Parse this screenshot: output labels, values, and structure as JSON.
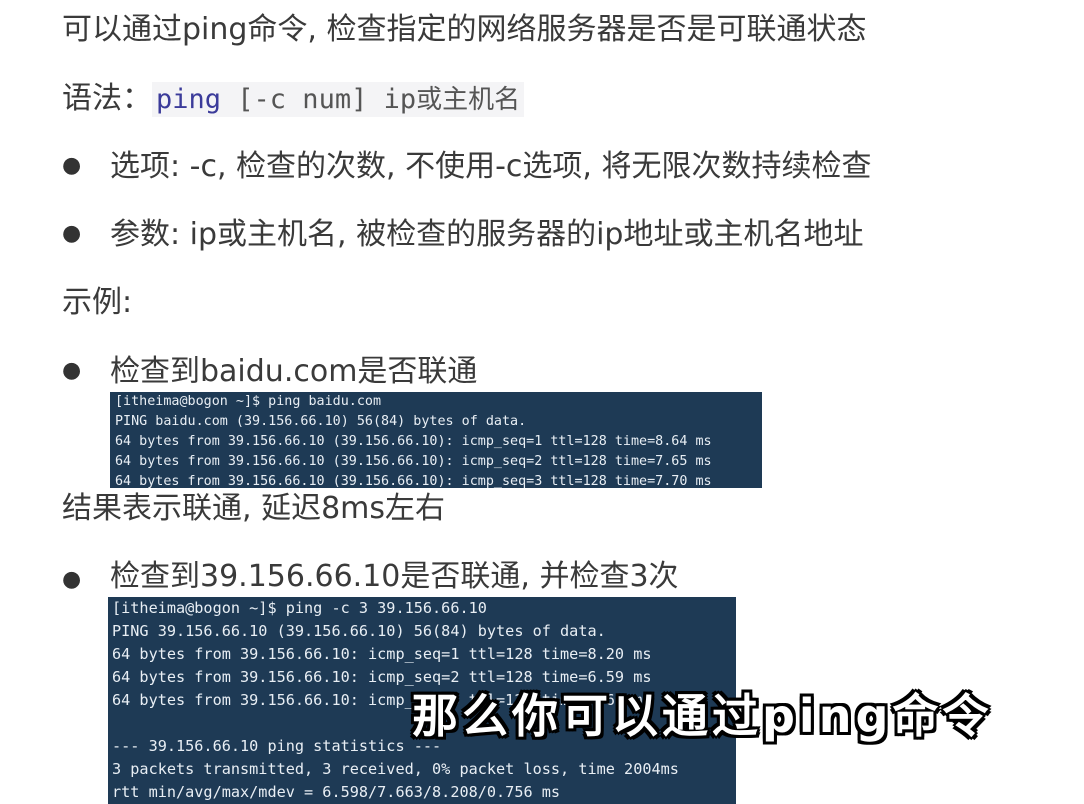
{
  "intro": "可以通过ping命令, 检查指定的网络服务器是否是可联通状态",
  "syntax": {
    "label": "语法：",
    "cmd": "ping",
    "args": " [-c num] ip",
    "tail": "或主机名"
  },
  "bullets": {
    "option": "选项: -c, 检查的次数, 不使用-c选项, 将无限次数持续检查",
    "param": "参数: ip或主机名, 被检查的服务器的ip地址或主机名地址"
  },
  "example_label": "示例:",
  "example1": {
    "title": "检查到baidu.com是否联通",
    "terminal": [
      "[itheima@bogon ~]$ ping baidu.com",
      "PING baidu.com (39.156.66.10) 56(84) bytes of data.",
      "64 bytes from 39.156.66.10 (39.156.66.10): icmp_seq=1 ttl=128 time=8.64 ms",
      "64 bytes from 39.156.66.10 (39.156.66.10): icmp_seq=2 ttl=128 time=7.65 ms",
      "64 bytes from 39.156.66.10 (39.156.66.10): icmp_seq=3 ttl=128 time=7.70 ms"
    ],
    "result": "结果表示联通, 延迟8ms左右"
  },
  "example2": {
    "title": "检查到39.156.66.10是否联通, 并检查3次",
    "terminal": [
      "[itheima@bogon ~]$ ping -c 3 39.156.66.10",
      "PING 39.156.66.10 (39.156.66.10) 56(84) bytes of data.",
      "64 bytes from 39.156.66.10: icmp_seq=1 ttl=128 time=8.20 ms",
      "64 bytes from 39.156.66.10: icmp_seq=2 ttl=128 time=6.59 ms",
      "64 bytes from 39.156.66.10: icmp_seq=3 ttl=128 time=7.66 ms",
      "",
      "--- 39.156.66.10 ping statistics ---",
      "3 packets transmitted, 3 received, 0% packet loss, time 2004ms",
      "rtt min/avg/max/mdev = 6.598/7.663/8.208/0.756 ms"
    ]
  },
  "subtitle": "那么你可以通过ping命令"
}
